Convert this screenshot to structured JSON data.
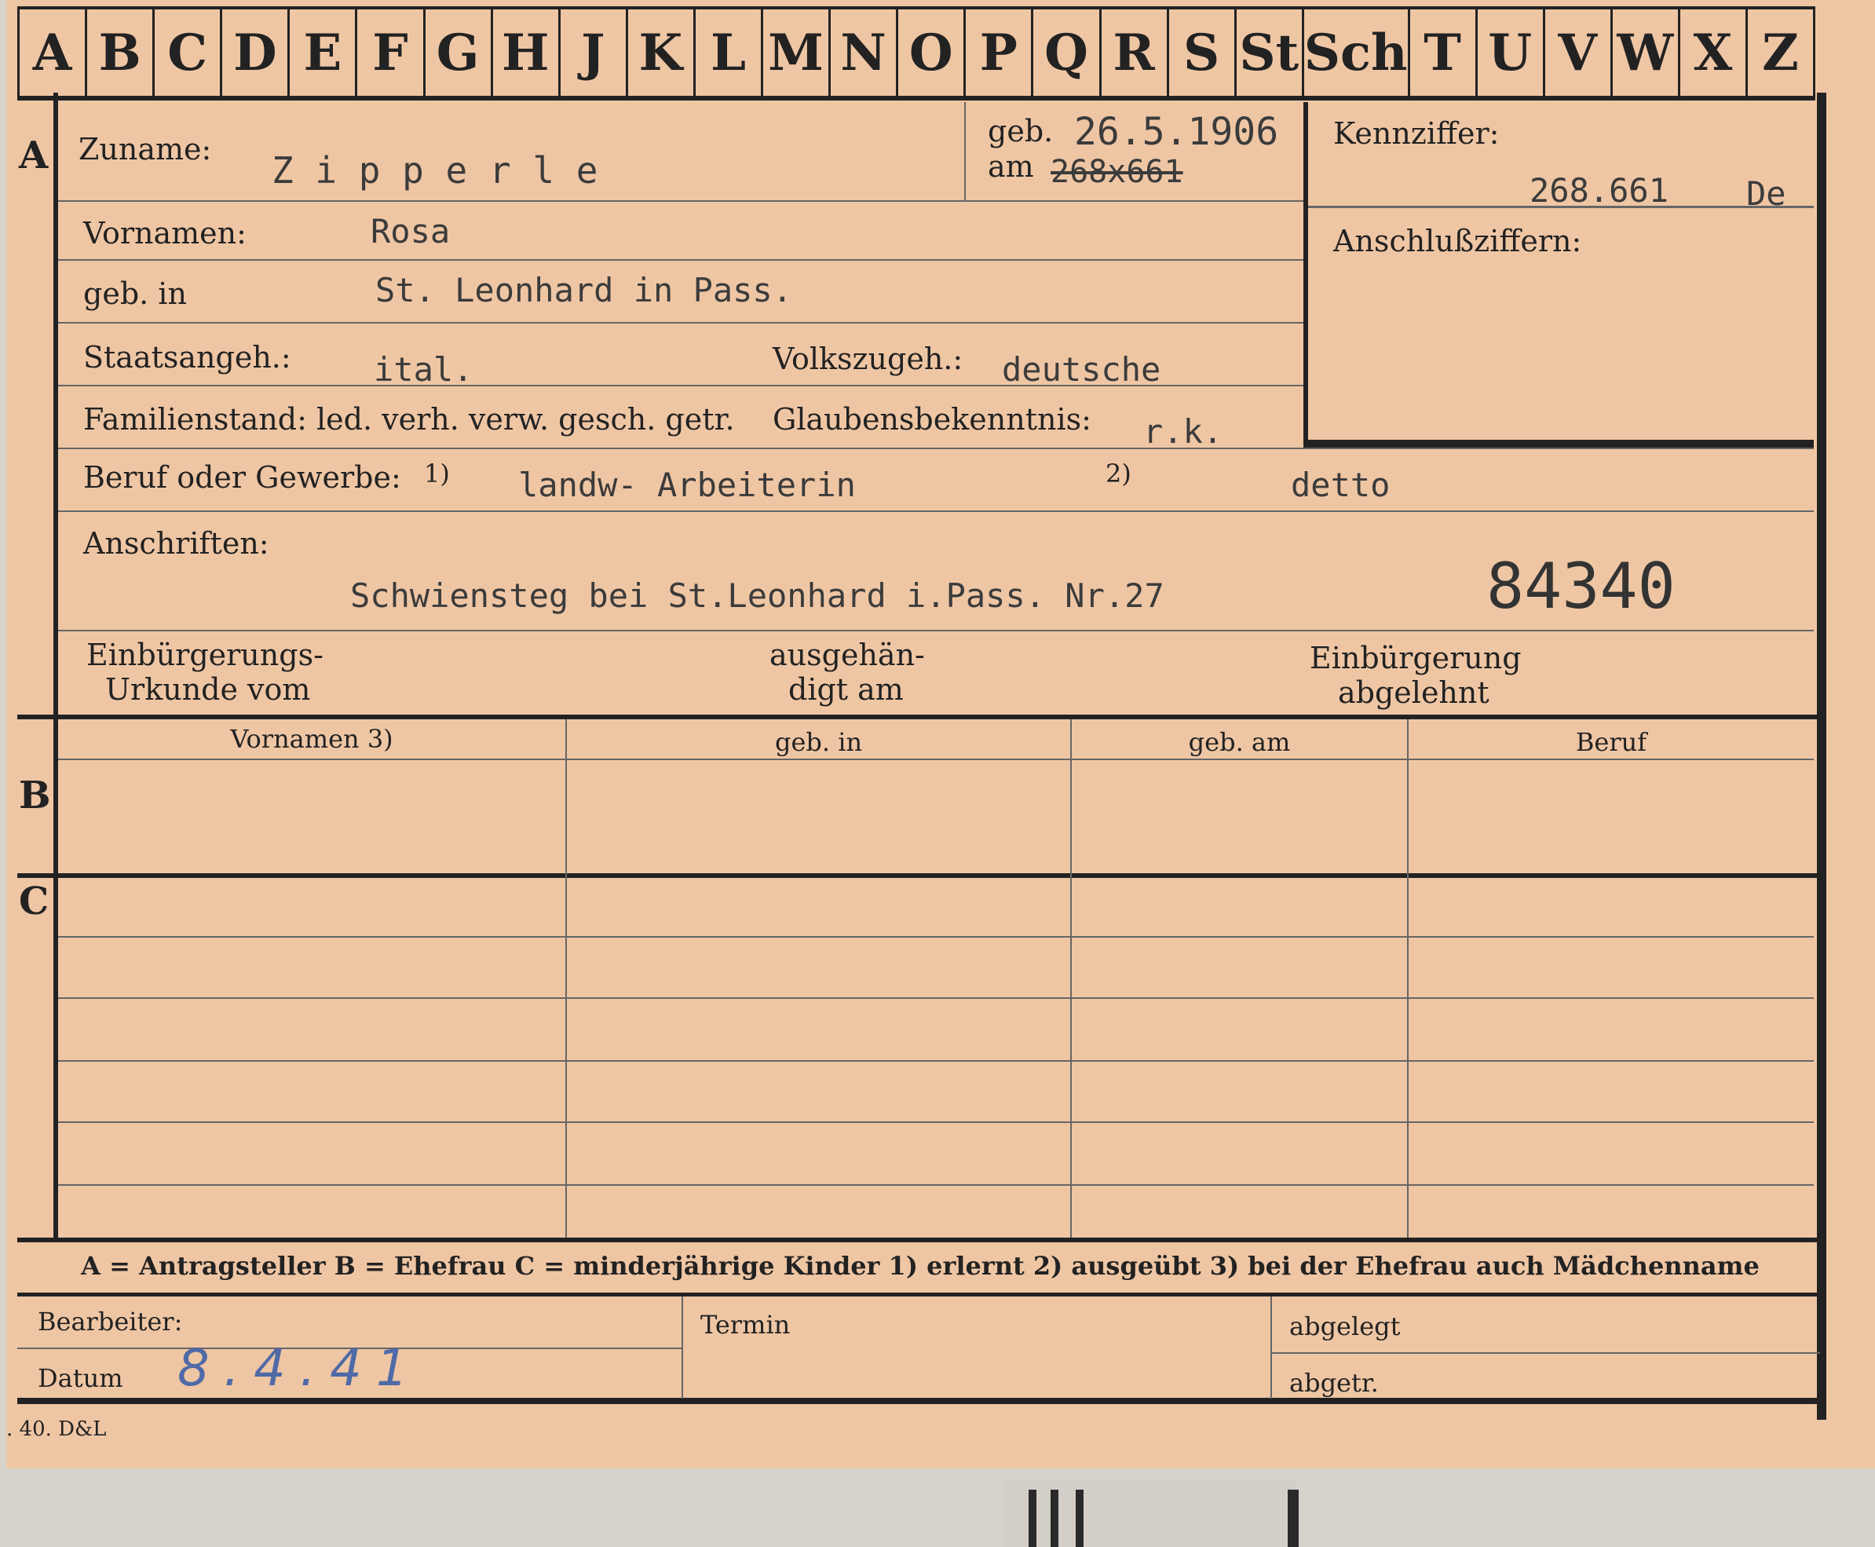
{
  "alphabet": [
    "A",
    "B",
    "C",
    "D",
    "E",
    "F",
    "G",
    "H",
    "J",
    "K",
    "L",
    "M",
    "N",
    "O",
    "P",
    "Q",
    "R",
    "S",
    "St",
    "Sch",
    "T",
    "U",
    "V",
    "W",
    "X",
    "Z"
  ],
  "sections": {
    "a": "A",
    "b": "B",
    "c": "C"
  },
  "fields": {
    "zuname_label": "Zuname:",
    "zuname_value": "Z i p p e r l e",
    "geb_am_label_1": "geb.",
    "geb_am_label_2": "am",
    "geb_date": "26.5.1906",
    "geb_struck": "268x661",
    "kennziffer_label": "Kennziffer:",
    "kennziffer_value": "268.661",
    "kennziffer_suffix": "De",
    "anschluss_label": "Anschlußziffern:",
    "vornamen_label": "Vornamen:",
    "vornamen_value": "Rosa",
    "gebin_label": "geb. in",
    "gebin_value": "St. Leonhard in Pass.",
    "staat_label": "Staatsangeh.:",
    "staat_value": "ital.",
    "volks_label": "Volkszugeh.:",
    "volks_value": "deutsche",
    "familien_label": "Familienstand: led. verh. verw. gesch. getr.",
    "glauben_label": "Glaubensbekenntnis:",
    "glauben_value": "r.k.",
    "beruf_label": "Beruf oder Gewerbe:",
    "beruf_sup1": "1)",
    "beruf_value1": "landw- Arbeiterin",
    "beruf_sup2": "2)",
    "beruf_value2": "detto",
    "anschriften_label": "Anschriften:",
    "anschriften_value": "Schwiensteg bei St.Leonhard i.Pass. Nr.27",
    "stamp_number": "84340",
    "einb_urkunde_1": "Einbürgerungs-",
    "einb_urkunde_2": "Urkunde vom",
    "ausgeh_1": "ausgehän-",
    "ausgeh_2": "digt am",
    "einb_abg_1": "Einbürgerung",
    "einb_abg_2": "abgelehnt"
  },
  "table_headers": [
    "Vornamen 3)",
    "geb. in",
    "geb. am",
    "Beruf"
  ],
  "legend": "A = Antragsteller   B = Ehefrau   C = minderjährige Kinder   1) erlernt   2) ausgeübt   3) bei der Ehefrau auch Mädchenname",
  "footer": {
    "bearbeiter_label": "Bearbeiter:",
    "datum_label": "Datum",
    "datum_value": "8.4.41",
    "termin_label": "Termin",
    "abgelegt_label": "abgelegt",
    "abgetr_label": "abgetr.",
    "print_code": ". 40. D&L"
  },
  "colors": {
    "card": "#efc6a4",
    "ink": "#222222",
    "typewriter": "#3b3b3b",
    "pencil": "#4f6aa6"
  }
}
